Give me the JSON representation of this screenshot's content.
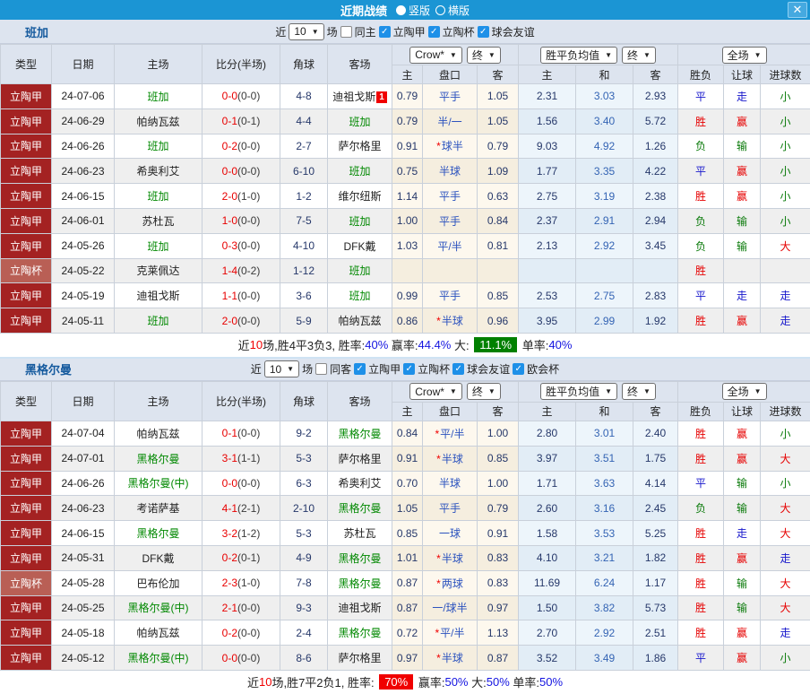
{
  "titlebar": {
    "title": "近期战绩",
    "radios": [
      {
        "label": "竖版",
        "selected": true
      },
      {
        "label": "横版",
        "selected": false
      }
    ],
    "close_label": "✕"
  },
  "table": {
    "main_columns": [
      "类型",
      "日期",
      "主场",
      "比分(半场)",
      "角球",
      "客场"
    ],
    "sub_columns": [
      "主",
      "盘口",
      "客",
      "主",
      "和",
      "客",
      "胜负",
      "让球",
      "进球数"
    ],
    "selects": {
      "company": "Crow*",
      "final": "终",
      "avg": "胜平负均值",
      "final2": "终",
      "scope": "全场"
    }
  },
  "sections": [
    {
      "team": "班加",
      "filter": {
        "near": "近",
        "count": "10",
        "games": "场",
        "same": {
          "label": "同主",
          "checked": false
        },
        "leagues": [
          {
            "label": "立陶甲",
            "checked": true
          },
          {
            "label": "立陶杯",
            "checked": true
          },
          {
            "label": "球会友谊",
            "checked": true
          }
        ]
      },
      "rows": [
        {
          "type": "立陶甲",
          "cup": false,
          "date": "24-07-06",
          "home": "班加",
          "home_active": true,
          "score": "0-0",
          "half": "(0-0)",
          "corners": "4-8",
          "away": "迪祖戈斯",
          "away_active": false,
          "badge": "1",
          "o1": "0.79",
          "star": false,
          "handicap": "平手",
          "o2": "1.05",
          "avg_home": "2.31",
          "avg_draw": "3.03",
          "avg_away": "2.93",
          "result": [
            "平",
            "blue"
          ],
          "handicap_result": [
            "走",
            "blue"
          ],
          "goals": [
            "小",
            "green"
          ]
        },
        {
          "type": "立陶甲",
          "cup": false,
          "date": "24-06-29",
          "home": "帕纳瓦兹",
          "home_active": false,
          "score": "0-1",
          "half": "(0-1)",
          "corners": "4-4",
          "away": "班加",
          "away_active": true,
          "badge": null,
          "o1": "0.79",
          "star": false,
          "handicap": "半/一",
          "o2": "1.05",
          "avg_home": "1.56",
          "avg_draw": "3.40",
          "avg_away": "5.72",
          "result": [
            "胜",
            "red"
          ],
          "handicap_result": [
            "赢",
            "red"
          ],
          "goals": [
            "小",
            "green"
          ]
        },
        {
          "type": "立陶甲",
          "cup": false,
          "date": "24-06-26",
          "home": "班加",
          "home_active": true,
          "score": "0-2",
          "half": "(0-0)",
          "corners": "2-7",
          "away": "萨尔格里",
          "away_active": false,
          "badge": null,
          "o1": "0.91",
          "star": true,
          "handicap": "球半",
          "o2": "0.79",
          "avg_home": "9.03",
          "avg_draw": "4.92",
          "avg_away": "1.26",
          "result": [
            "负",
            "green"
          ],
          "handicap_result": [
            "输",
            "green"
          ],
          "goals": [
            "小",
            "green"
          ]
        },
        {
          "type": "立陶甲",
          "cup": false,
          "date": "24-06-23",
          "home": "希奥利艾",
          "home_active": false,
          "score": "0-0",
          "half": "(0-0)",
          "corners": "6-10",
          "away": "班加",
          "away_active": true,
          "badge": null,
          "o1": "0.75",
          "star": false,
          "handicap": "半球",
          "o2": "1.09",
          "avg_home": "1.77",
          "avg_draw": "3.35",
          "avg_away": "4.22",
          "result": [
            "平",
            "blue"
          ],
          "handicap_result": [
            "赢",
            "red"
          ],
          "goals": [
            "小",
            "green"
          ]
        },
        {
          "type": "立陶甲",
          "cup": false,
          "date": "24-06-15",
          "home": "班加",
          "home_active": true,
          "score": "2-0",
          "half": "(1-0)",
          "corners": "1-2",
          "away": "维尔纽斯",
          "away_active": false,
          "badge": null,
          "o1": "1.14",
          "star": false,
          "handicap": "平手",
          "o2": "0.63",
          "avg_home": "2.75",
          "avg_draw": "3.19",
          "avg_away": "2.38",
          "result": [
            "胜",
            "red"
          ],
          "handicap_result": [
            "赢",
            "red"
          ],
          "goals": [
            "小",
            "green"
          ]
        },
        {
          "type": "立陶甲",
          "cup": false,
          "date": "24-06-01",
          "home": "苏杜瓦",
          "home_active": false,
          "score": "1-0",
          "half": "(0-0)",
          "corners": "7-5",
          "away": "班加",
          "away_active": true,
          "badge": null,
          "o1": "1.00",
          "star": false,
          "handicap": "平手",
          "o2": "0.84",
          "avg_home": "2.37",
          "avg_draw": "2.91",
          "avg_away": "2.94",
          "result": [
            "负",
            "green"
          ],
          "handicap_result": [
            "输",
            "green"
          ],
          "goals": [
            "小",
            "green"
          ]
        },
        {
          "type": "立陶甲",
          "cup": false,
          "date": "24-05-26",
          "home": "班加",
          "home_active": true,
          "score": "0-3",
          "half": "(0-0)",
          "corners": "4-10",
          "away": "DFK戴",
          "away_active": false,
          "badge": null,
          "o1": "1.03",
          "star": false,
          "handicap": "平/半",
          "o2": "0.81",
          "avg_home": "2.13",
          "avg_draw": "2.92",
          "avg_away": "3.45",
          "result": [
            "负",
            "green"
          ],
          "handicap_result": [
            "输",
            "green"
          ],
          "goals": [
            "大",
            "red"
          ]
        },
        {
          "type": "立陶杯",
          "cup": true,
          "date": "24-05-22",
          "home": "克莱佩达",
          "home_active": false,
          "score": "1-4",
          "half": "(0-2)",
          "corners": "1-12",
          "away": "班加",
          "away_active": true,
          "badge": null,
          "o1": "",
          "star": false,
          "handicap": "",
          "o2": "",
          "avg_home": "",
          "avg_draw": "",
          "avg_away": "",
          "result": [
            "胜",
            "red"
          ],
          "handicap_result": [
            "",
            ""
          ],
          "goals": [
            "",
            ""
          ]
        },
        {
          "type": "立陶甲",
          "cup": false,
          "date": "24-05-19",
          "home": "迪祖戈斯",
          "home_active": false,
          "score": "1-1",
          "half": "(0-0)",
          "corners": "3-6",
          "away": "班加",
          "away_active": true,
          "badge": null,
          "o1": "0.99",
          "star": false,
          "handicap": "平手",
          "o2": "0.85",
          "avg_home": "2.53",
          "avg_draw": "2.75",
          "avg_away": "2.83",
          "result": [
            "平",
            "blue"
          ],
          "handicap_result": [
            "走",
            "blue"
          ],
          "goals": [
            "走",
            "blue"
          ]
        },
        {
          "type": "立陶甲",
          "cup": false,
          "date": "24-05-11",
          "home": "班加",
          "home_active": true,
          "score": "2-0",
          "half": "(0-0)",
          "corners": "5-9",
          "away": "帕纳瓦兹",
          "away_active": false,
          "badge": null,
          "o1": "0.86",
          "star": true,
          "handicap": "半球",
          "o2": "0.96",
          "avg_home": "3.95",
          "avg_draw": "2.99",
          "avg_away": "1.92",
          "result": [
            "胜",
            "red"
          ],
          "handicap_result": [
            "赢",
            "red"
          ],
          "goals": [
            "走",
            "blue"
          ]
        }
      ],
      "summary": [
        [
          "近",
          ""
        ],
        [
          "10",
          "s-red"
        ],
        [
          "场,胜4平3负3, 胜率:",
          ""
        ],
        [
          "40%",
          "s-blue"
        ],
        [
          " 赢率:",
          ""
        ],
        [
          "44.4%",
          "s-blue"
        ],
        [
          " 大: ",
          ""
        ],
        [
          "11.1%",
          "badge-green"
        ],
        [
          " 单率:",
          ""
        ],
        [
          "40%",
          "s-blue"
        ]
      ]
    },
    {
      "team": "黑格尔曼",
      "filter": {
        "near": "近",
        "count": "10",
        "games": "场",
        "same": {
          "label": "同客",
          "checked": false
        },
        "leagues": [
          {
            "label": "立陶甲",
            "checked": true
          },
          {
            "label": "立陶杯",
            "checked": true
          },
          {
            "label": "球会友谊",
            "checked": true
          },
          {
            "label": "欧会杯",
            "checked": true
          }
        ]
      },
      "rows": [
        {
          "type": "立陶甲",
          "cup": false,
          "date": "24-07-04",
          "home": "帕纳瓦兹",
          "home_active": false,
          "score": "0-1",
          "half": "(0-0)",
          "corners": "9-2",
          "away": "黑格尔曼",
          "away_active": true,
          "badge": null,
          "o1": "0.84",
          "star": true,
          "handicap": "平/半",
          "o2": "1.00",
          "avg_home": "2.80",
          "avg_draw": "3.01",
          "avg_away": "2.40",
          "result": [
            "胜",
            "red"
          ],
          "handicap_result": [
            "赢",
            "red"
          ],
          "goals": [
            "小",
            "green"
          ]
        },
        {
          "type": "立陶甲",
          "cup": false,
          "date": "24-07-01",
          "home": "黑格尔曼",
          "home_active": true,
          "score": "3-1",
          "half": "(1-1)",
          "corners": "5-3",
          "away": "萨尔格里",
          "away_active": false,
          "badge": null,
          "o1": "0.91",
          "star": true,
          "handicap": "半球",
          "o2": "0.85",
          "avg_home": "3.97",
          "avg_draw": "3.51",
          "avg_away": "1.75",
          "result": [
            "胜",
            "red"
          ],
          "handicap_result": [
            "赢",
            "red"
          ],
          "goals": [
            "大",
            "red"
          ]
        },
        {
          "type": "立陶甲",
          "cup": false,
          "date": "24-06-26",
          "home": "黑格尔曼(中)",
          "home_active": true,
          "score": "0-0",
          "half": "(0-0)",
          "corners": "6-3",
          "away": "希奥利艾",
          "away_active": false,
          "badge": null,
          "o1": "0.70",
          "star": false,
          "handicap": "半球",
          "o2": "1.00",
          "avg_home": "1.71",
          "avg_draw": "3.63",
          "avg_away": "4.14",
          "result": [
            "平",
            "blue"
          ],
          "handicap_result": [
            "输",
            "green"
          ],
          "goals": [
            "小",
            "green"
          ]
        },
        {
          "type": "立陶甲",
          "cup": false,
          "date": "24-06-23",
          "home": "考诺萨基",
          "home_active": false,
          "score": "4-1",
          "half": "(2-1)",
          "corners": "2-10",
          "away": "黑格尔曼",
          "away_active": true,
          "badge": null,
          "o1": "1.05",
          "star": false,
          "handicap": "平手",
          "o2": "0.79",
          "avg_home": "2.60",
          "avg_draw": "3.16",
          "avg_away": "2.45",
          "result": [
            "负",
            "green"
          ],
          "handicap_result": [
            "输",
            "green"
          ],
          "goals": [
            "大",
            "red"
          ]
        },
        {
          "type": "立陶甲",
          "cup": false,
          "date": "24-06-15",
          "home": "黑格尔曼",
          "home_active": true,
          "score": "3-2",
          "half": "(1-2)",
          "corners": "5-3",
          "away": "苏杜瓦",
          "away_active": false,
          "badge": null,
          "o1": "0.85",
          "star": false,
          "handicap": "一球",
          "o2": "0.91",
          "avg_home": "1.58",
          "avg_draw": "3.53",
          "avg_away": "5.25",
          "result": [
            "胜",
            "red"
          ],
          "handicap_result": [
            "走",
            "blue"
          ],
          "goals": [
            "大",
            "red"
          ]
        },
        {
          "type": "立陶甲",
          "cup": false,
          "date": "24-05-31",
          "home": "DFK戴",
          "home_active": false,
          "score": "0-2",
          "half": "(0-1)",
          "corners": "4-9",
          "away": "黑格尔曼",
          "away_active": true,
          "badge": null,
          "o1": "1.01",
          "star": true,
          "handicap": "半球",
          "o2": "0.83",
          "avg_home": "4.10",
          "avg_draw": "3.21",
          "avg_away": "1.82",
          "result": [
            "胜",
            "red"
          ],
          "handicap_result": [
            "赢",
            "red"
          ],
          "goals": [
            "走",
            "blue"
          ]
        },
        {
          "type": "立陶杯",
          "cup": true,
          "date": "24-05-28",
          "home": "巴布伦加",
          "home_active": false,
          "score": "2-3",
          "half": "(1-0)",
          "corners": "7-8",
          "away": "黑格尔曼",
          "away_active": true,
          "badge": null,
          "o1": "0.87",
          "star": true,
          "handicap": "两球",
          "o2": "0.83",
          "avg_home": "11.69",
          "avg_draw": "6.24",
          "avg_away": "1.17",
          "result": [
            "胜",
            "red"
          ],
          "handicap_result": [
            "输",
            "green"
          ],
          "goals": [
            "大",
            "red"
          ]
        },
        {
          "type": "立陶甲",
          "cup": false,
          "date": "24-05-25",
          "home": "黑格尔曼(中)",
          "home_active": true,
          "score": "2-1",
          "half": "(0-0)",
          "corners": "9-3",
          "away": "迪祖戈斯",
          "away_active": false,
          "badge": null,
          "o1": "0.87",
          "star": false,
          "handicap": "一/球半",
          "o2": "0.97",
          "avg_home": "1.50",
          "avg_draw": "3.82",
          "avg_away": "5.73",
          "result": [
            "胜",
            "red"
          ],
          "handicap_result": [
            "输",
            "green"
          ],
          "goals": [
            "大",
            "red"
          ]
        },
        {
          "type": "立陶甲",
          "cup": false,
          "date": "24-05-18",
          "home": "帕纳瓦兹",
          "home_active": false,
          "score": "0-2",
          "half": "(0-0)",
          "corners": "2-4",
          "away": "黑格尔曼",
          "away_active": true,
          "badge": null,
          "o1": "0.72",
          "star": true,
          "handicap": "平/半",
          "o2": "1.13",
          "avg_home": "2.70",
          "avg_draw": "2.92",
          "avg_away": "2.51",
          "result": [
            "胜",
            "red"
          ],
          "handicap_result": [
            "赢",
            "red"
          ],
          "goals": [
            "走",
            "blue"
          ]
        },
        {
          "type": "立陶甲",
          "cup": false,
          "date": "24-05-12",
          "home": "黑格尔曼(中)",
          "home_active": true,
          "score": "0-0",
          "half": "(0-0)",
          "corners": "8-6",
          "away": "萨尔格里",
          "away_active": false,
          "badge": null,
          "o1": "0.97",
          "star": true,
          "handicap": "半球",
          "o2": "0.87",
          "avg_home": "3.52",
          "avg_draw": "3.49",
          "avg_away": "1.86",
          "result": [
            "平",
            "blue"
          ],
          "handicap_result": [
            "赢",
            "red"
          ],
          "goals": [
            "小",
            "green"
          ]
        }
      ],
      "summary": [
        [
          "近",
          ""
        ],
        [
          "10",
          "s-red"
        ],
        [
          "场,胜7平2负1, 胜率: ",
          ""
        ],
        [
          "70%",
          "badge-red"
        ],
        [
          " 赢率:",
          ""
        ],
        [
          "50%",
          "s-blue"
        ],
        [
          " 大:",
          ""
        ],
        [
          "50%",
          "s-blue"
        ],
        [
          " 单率:",
          ""
        ],
        [
          "50%",
          "s-blue"
        ]
      ]
    }
  ]
}
